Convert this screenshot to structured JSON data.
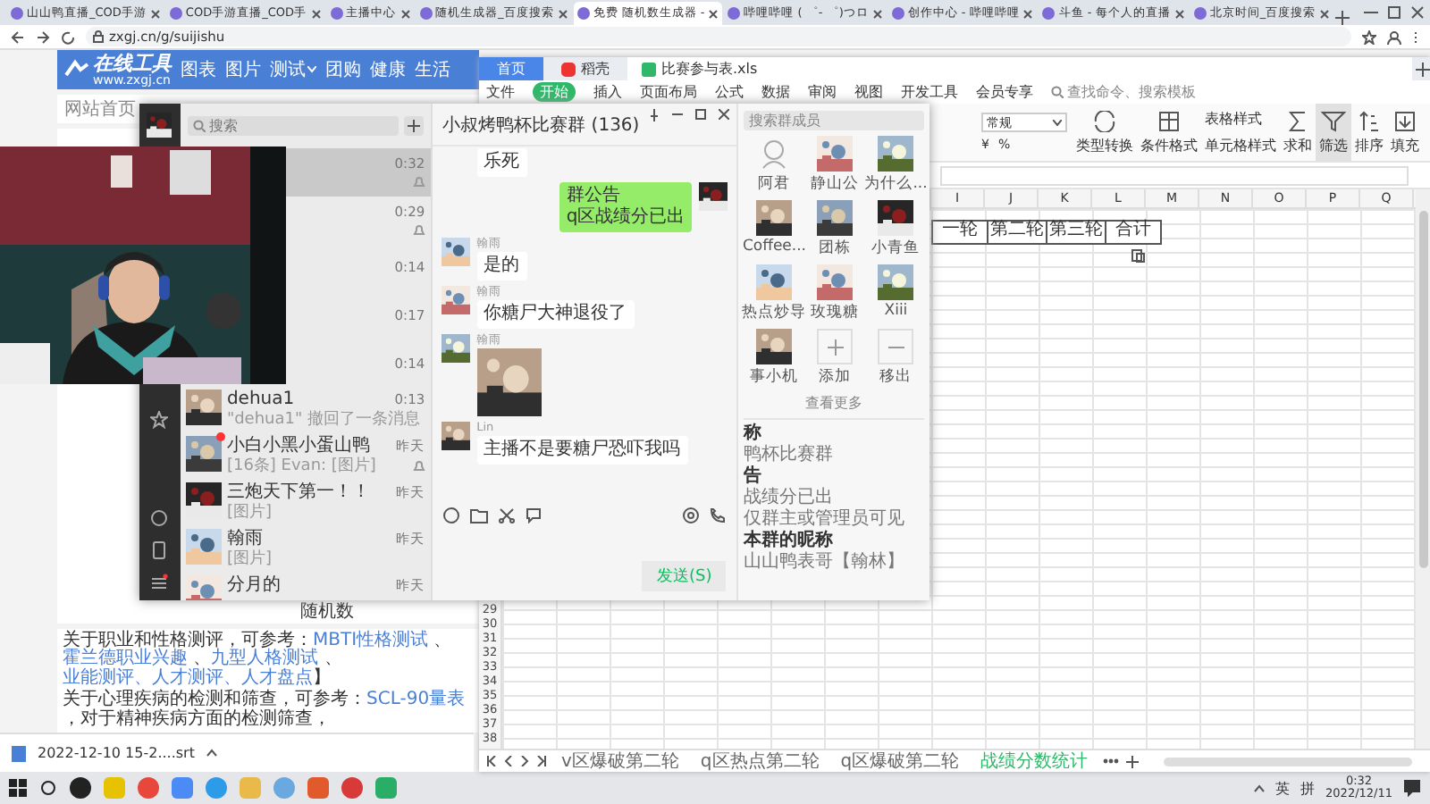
{
  "browser": {
    "tabs": [
      {
        "title": "山山鸭直播_COD手游",
        "selected": false
      },
      {
        "title": "COD手游直播_COD手",
        "selected": false
      },
      {
        "title": "主播中心",
        "selected": false
      },
      {
        "title": "随机生成器_百度搜索",
        "selected": false
      },
      {
        "title": "免费 随机数生成器 -",
        "selected": true
      },
      {
        "title": "哔哩哔哩 ( ゜- ゜)つロ",
        "selected": false
      },
      {
        "title": "创作中心 - 哔哩哔哩",
        "selected": false
      },
      {
        "title": "斗鱼 - 每个人的直播",
        "selected": false
      },
      {
        "title": "北京时间_百度搜索",
        "selected": false
      }
    ],
    "url": "zxgj.cn/g/suijishu"
  },
  "website": {
    "logo": "在线工具",
    "logo_url": "www.zxgj.cn",
    "nav": [
      {
        "label": "图表",
        "dropdown": false
      },
      {
        "label": "图片",
        "dropdown": false
      },
      {
        "label": "测试",
        "dropdown": true
      },
      {
        "label": "团购",
        "dropdown": false
      },
      {
        "label": "健康",
        "dropdown": false
      },
      {
        "label": "生活",
        "dropdown": false
      }
    ],
    "breadcrumb": "网站首页",
    "caption": "随机数",
    "paragraphs": [
      [
        {
          "text": "关于职业和性格测评，可参考："
        },
        {
          "text": "MBTI性格测试",
          "link": true
        },
        {
          "text": " 、"
        },
        {
          "text": "霍兰德职业兴趣",
          "link": true
        },
        {
          "text": " 、"
        },
        {
          "text": "九型人格测试",
          "link": true
        },
        {
          "text": " 、"
        },
        {
          "text": "业能测评、人才测评、人才盘点",
          "link": true
        },
        {
          "text": "】"
        }
      ],
      [
        {
          "text": "关于心理疾病的检测和筛查，可参考："
        },
        {
          "text": "SCL-90量表",
          "link": true
        },
        {
          "text": " ，对于精神疾病方面的检测筛查，"
        }
      ]
    ]
  },
  "download": {
    "file": "2022-12-10 15-2....srt"
  },
  "wps": {
    "tabs": [
      {
        "label": "首页",
        "kind": "home",
        "selected": false
      },
      {
        "label": "稻壳",
        "kind": "docer",
        "selected": false
      },
      {
        "label": "比赛参与表.xls",
        "kind": "sheet",
        "selected": true
      }
    ],
    "menu": [
      {
        "label": "文件",
        "selected": false
      },
      {
        "label": "开始",
        "selected": true
      },
      {
        "label": "插入",
        "selected": false
      },
      {
        "label": "页面布局",
        "selected": false
      },
      {
        "label": "公式",
        "selected": false
      },
      {
        "label": "数据",
        "selected": false
      },
      {
        "label": "审阅",
        "selected": false
      },
      {
        "label": "视图",
        "selected": false
      },
      {
        "label": "开发工具",
        "selected": false
      },
      {
        "label": "会员专享",
        "selected": false
      }
    ],
    "search": {
      "placeholder": "查找命令、搜索模板"
    },
    "ribbon": [
      {
        "kind": "dropdown",
        "label": "常规",
        "symbols": [
          "¥",
          "%"
        ]
      },
      {
        "kind": "big",
        "label": "类型转换",
        "selected": false
      },
      {
        "kind": "big",
        "label": "条件格式",
        "selected": false
      },
      {
        "kind": "stack",
        "labels": [
          "表格样式",
          "单元格样式"
        ]
      },
      {
        "kind": "big",
        "label": "求和",
        "selected": false
      },
      {
        "kind": "big",
        "label": "筛选",
        "selected": true
      },
      {
        "kind": "big",
        "label": "排序",
        "selected": false
      },
      {
        "kind": "big",
        "label": "填充",
        "selected": false
      }
    ],
    "columns": [
      "I",
      "J",
      "K",
      "L",
      "M",
      "N",
      "O",
      "P",
      "Q"
    ],
    "header_cells": [
      "一轮",
      "第二轮",
      "第三轮",
      "合计"
    ],
    "row_numbers": [
      "29",
      "30",
      "31",
      "32",
      "33",
      "34",
      "35",
      "36",
      "37",
      "38"
    ],
    "sheets": [
      {
        "label": "v区爆破第二轮",
        "selected": false
      },
      {
        "label": "q区热点第二轮",
        "selected": false
      },
      {
        "label": "q区爆破第二轮",
        "selected": false
      },
      {
        "label": "战绩分数统计",
        "selected": true
      }
    ]
  },
  "wechat": {
    "search": {
      "placeholder": "搜索"
    },
    "chats": [
      {
        "time": "0:32",
        "selected": true,
        "muted": true
      },
      {
        "time": "0:29",
        "selected": false,
        "muted": true
      },
      {
        "time": "0:14",
        "selected": false,
        "muted": false
      },
      {
        "time": "0:17",
        "selected": false,
        "muted": false
      },
      {
        "time": "0:14",
        "selected": false,
        "muted": false
      },
      {
        "name": "dehua1",
        "preview": "\"dehua1\" 撤回了一条消息",
        "time": "0:13",
        "selected": false,
        "unread": false,
        "muted": false
      },
      {
        "name": "小白小黑小蛋山鸭",
        "preview": "[16条] Evan: [图片]",
        "time": "昨天",
        "selected": false,
        "unread": true,
        "muted": true
      },
      {
        "name": "三炮天下第一！！",
        "preview": "[图片]",
        "time": "昨天",
        "selected": false,
        "unread": false,
        "muted": false
      },
      {
        "name": "翰雨",
        "preview": "[图片]",
        "time": "昨天",
        "selected": false,
        "unread": false,
        "muted": false
      },
      {
        "name": "分月的",
        "time": "昨天",
        "selected": false,
        "unread": false,
        "muted": false
      }
    ],
    "title": "小叔烤鸭杯比赛群 (136)",
    "messages": [
      {
        "kind": "text",
        "text": "乐死",
        "outgoing": false
      },
      {
        "kind": "text",
        "text": "群公告\nq区战绩分已出",
        "outgoing": true
      },
      {
        "kind": "text",
        "sender": "翰雨",
        "text": "是的",
        "outgoing": false
      },
      {
        "kind": "text",
        "sender": "翰雨",
        "text": "你糖尸大神退役了",
        "outgoing": false
      },
      {
        "sender": "翰雨",
        "outgoing": false
      },
      {
        "kind": "text",
        "sender": "Lin",
        "text": "主播不是要糖尸恐吓我吗",
        "outgoing": false
      }
    ],
    "send": "发送(S)",
    "members": {
      "search": {
        "placeholder": "搜索群成员"
      },
      "items": [
        {
          "name": "阿君",
          "kind": "default"
        },
        {
          "name": "静山公",
          "kind": "member"
        },
        {
          "name": "为什么...",
          "kind": "member"
        },
        {
          "name": "Coffee...",
          "kind": "member"
        },
        {
          "name": "团栋",
          "kind": "member"
        },
        {
          "name": "小青鱼",
          "kind": "member"
        },
        {
          "name": "热点炒导",
          "kind": "member"
        },
        {
          "name": "玫瑰糖",
          "kind": "member"
        },
        {
          "name": "Xiii",
          "kind": "member"
        },
        {
          "name": "事小机",
          "kind": "member"
        },
        {
          "name": "添加",
          "kind": "add"
        },
        {
          "name": "移出",
          "kind": "remove"
        }
      ],
      "more": "查看更多",
      "info": [
        {
          "label": "称",
          "value": "鸭杯比赛群"
        },
        {
          "label": "告",
          "value": "战绩分已出"
        },
        {
          "value": "仅群主或管理员可见"
        },
        {
          "label": "本群的昵称",
          "value": "山山鸭表哥【翰林】"
        }
      ]
    }
  },
  "taskbar": {
    "tray": [
      "英",
      "拼"
    ],
    "time": "0:32",
    "date": "2022/12/11"
  }
}
